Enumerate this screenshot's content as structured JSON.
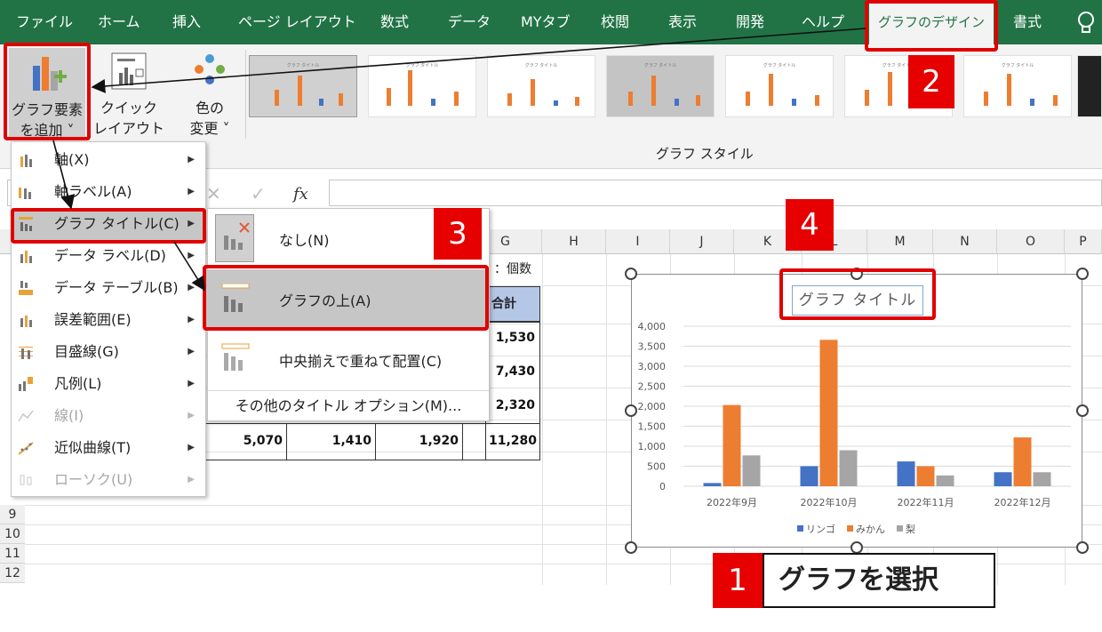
{
  "ribbon_tabs": [
    "ファイル",
    "ホーム",
    "挿入",
    "ページ レイアウト",
    "数式",
    "データ",
    "MYタブ",
    "校閲",
    "表示",
    "開発",
    "ヘルプ",
    "グラフのデザイン",
    "書式"
  ],
  "ribbon": {
    "add_element": {
      "line1": "グラフ要素",
      "line2": "を追加 ˅"
    },
    "quick_layout": {
      "line1": "クイック",
      "line2": "レイアウト ˅"
    },
    "change_color": {
      "line1": "色の",
      "line2": "変更 ˅"
    },
    "styles_group_label": "グラフ スタイル",
    "style_thumb_title": "グラフ タイトル"
  },
  "formula_bar": {
    "fx": "fx",
    "cancel": "✕",
    "enter": "✓"
  },
  "grid": {
    "columns": [
      "G",
      "H",
      "I",
      "J",
      "K",
      "L",
      "M",
      "N",
      "O",
      "P"
    ],
    "rows": [
      "9",
      "10",
      "11",
      "12"
    ],
    "note": "：個数",
    "total_header": "合計",
    "totals": [
      "1,530",
      "7,430",
      "2,320"
    ],
    "bottom_row": [
      "5,070",
      "1,410",
      "1,920",
      "11,280"
    ]
  },
  "menu": {
    "items": [
      {
        "label": "軸(X)",
        "icon": "axis-icon",
        "disabled": false
      },
      {
        "label": "軸ラベル(A)",
        "icon": "axis-label-icon",
        "disabled": false
      },
      {
        "label": "グラフ タイトル(C)",
        "icon": "chart-title-icon",
        "disabled": false
      },
      {
        "label": "データ ラベル(D)",
        "icon": "data-label-icon",
        "disabled": false
      },
      {
        "label": "データ テーブル(B)",
        "icon": "data-table-icon",
        "disabled": false
      },
      {
        "label": "誤差範囲(E)",
        "icon": "error-bars-icon",
        "disabled": false
      },
      {
        "label": "目盛線(G)",
        "icon": "gridlines-icon",
        "disabled": false
      },
      {
        "label": "凡例(L)",
        "icon": "legend-icon",
        "disabled": false
      },
      {
        "label": "線(I)",
        "icon": "lines-icon",
        "disabled": true
      },
      {
        "label": "近似曲線(T)",
        "icon": "trendline-icon",
        "disabled": false
      },
      {
        "label": "ローソク(U)",
        "icon": "candlestick-icon",
        "disabled": true
      }
    ]
  },
  "submenu": {
    "none": "なし(N)",
    "above": "グラフの上(A)",
    "centered": "中央揃えで重ねて配置(C)",
    "more": "その他のタイトル オプション(M)..."
  },
  "annotations": {
    "step1": "1",
    "step1_text": "グラフを選択",
    "step2": "2",
    "step3": "3",
    "step4": "4"
  },
  "colors": {
    "excel_green": "#217346",
    "red": "#e00000",
    "apple": "#4472c4",
    "orange": "#ed7d31",
    "pear": "#a5a5a5"
  },
  "chart_data": {
    "type": "bar",
    "title": "グラフ タイトル",
    "categories": [
      "2022年9月",
      "2022年10月",
      "2022年11月",
      "2022年12月"
    ],
    "series": [
      {
        "name": "リンゴ",
        "values": [
          80,
          500,
          620,
          350
        ]
      },
      {
        "name": "みかん",
        "values": [
          2030,
          3660,
          500,
          1220
        ]
      },
      {
        "name": "梨",
        "values": [
          770,
          900,
          270,
          350
        ]
      }
    ],
    "ylim": [
      0,
      4000
    ],
    "yticks": [
      "0",
      "500",
      "1,000",
      "1,500",
      "2,000",
      "2,500",
      "3,000",
      "3,500",
      "4,000"
    ],
    "grid": true,
    "legend": "bottom"
  }
}
